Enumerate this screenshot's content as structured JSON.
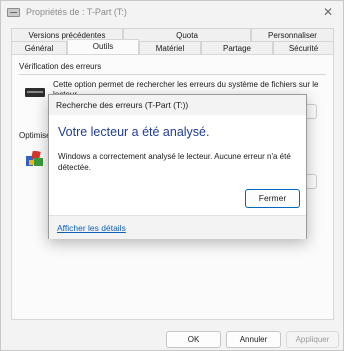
{
  "window": {
    "title": "Propriétés de : T-Part (T:)",
    "close_glyph": "✕"
  },
  "tabs": {
    "row1": [
      "Versions précédentes",
      "Quota",
      "Personnaliser"
    ],
    "row2": [
      "Général",
      "Outils",
      "Matériel",
      "Partage",
      "Sécurité"
    ],
    "active": "Outils"
  },
  "panel": {
    "error_check_title": "Vérification des erreurs",
    "error_check_desc": "Cette option permet de rechercher les erreurs du système de fichiers sur le lecteur.",
    "optimize_title": "Optimiser"
  },
  "footer": {
    "ok": "OK",
    "cancel": "Annuler",
    "apply": "Appliquer"
  },
  "dialog": {
    "title": "Recherche des erreurs (T-Part (T:))",
    "heading": "Votre lecteur a été analysé.",
    "body": "Windows a correctement analysé le lecteur. Aucune erreur n'a été détectée.",
    "close_button": "Fermer",
    "details_link": "Afficher les détails"
  },
  "colors": {
    "heading": "#1f3d9a",
    "link": "#0b5fb8",
    "accent_border": "#0067c0"
  }
}
